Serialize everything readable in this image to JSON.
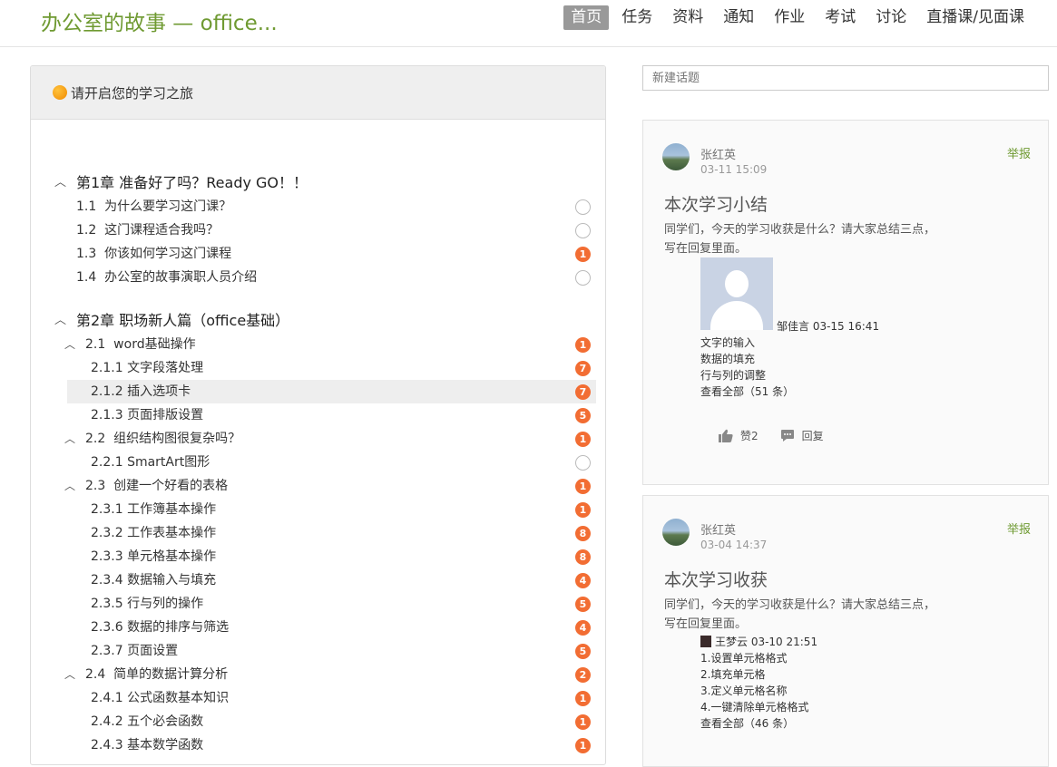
{
  "header": {
    "title": "办公室的故事 — office...",
    "nav": [
      "首页",
      "任务",
      "资料",
      "通知",
      "作业",
      "考试",
      "讨论",
      "直播课/见面课"
    ]
  },
  "course": {
    "banner": "请开启您的学习之旅",
    "chapters": [
      {
        "title": "第1章 准备好了吗？Ready GO！！",
        "items": [
          {
            "num": "1.1",
            "label": "为什么要学习这门课？",
            "badge": ""
          },
          {
            "num": "1.2",
            "label": "这门课程适合我吗？",
            "badge": ""
          },
          {
            "num": "1.3",
            "label": "你该如何学习这门课程",
            "badge": "1"
          },
          {
            "num": "1.4",
            "label": "办公室的故事演职人员介绍",
            "badge": ""
          }
        ]
      },
      {
        "title": "第2章 职场新人篇（office基础）",
        "sections": [
          {
            "num": "2.1",
            "label": "word基础操作",
            "badge": "1",
            "items": [
              {
                "label": "2.1.1 文字段落处理",
                "badge": "7"
              },
              {
                "label": "2.1.2 插入选项卡",
                "badge": "7"
              },
              {
                "label": "2.1.3 页面排版设置",
                "badge": "5"
              }
            ]
          },
          {
            "num": "2.2",
            "label": "组织结构图很复杂吗？",
            "badge": "1",
            "items": [
              {
                "label": "2.2.1 SmartArt图形",
                "badge": ""
              }
            ]
          },
          {
            "num": "2.3",
            "label": "创建一个好看的表格",
            "badge": "1",
            "items": [
              {
                "label": "2.3.1 工作簿基本操作",
                "badge": "1"
              },
              {
                "label": "2.3.2 工作表基本操作",
                "badge": "8"
              },
              {
                "label": "2.3.3 单元格基本操作",
                "badge": "8"
              },
              {
                "label": "2.3.4 数据输入与填充",
                "badge": "4"
              },
              {
                "label": "2.3.5 行与列的操作",
                "badge": "5"
              },
              {
                "label": "2.3.6 数据的排序与筛选",
                "badge": "4"
              },
              {
                "label": "2.3.7 页面设置",
                "badge": "5"
              }
            ]
          },
          {
            "num": "2.4",
            "label": "简单的数据计算分析",
            "badge": "2",
            "items": [
              {
                "label": "2.4.1 公式函数基本知识",
                "badge": "1"
              },
              {
                "label": "2.4.2 五个必会函数",
                "badge": "1"
              },
              {
                "label": "2.4.3 基本数学函数",
                "badge": "1"
              }
            ]
          }
        ]
      }
    ]
  },
  "feed": {
    "new_topic_placeholder": "新建话题",
    "posts": [
      {
        "author": "张红英",
        "date": "03-11 15:09",
        "report": "举报",
        "title": "本次学习小结",
        "body_line1": "同学们，今天的学习收获是什么？请大家总结三点，",
        "body_line2": "写在回复里面。",
        "reply_author_meta": "邹佳言 03-15 16:41",
        "reply_lines": [
          "文字的输入",
          "数据的填充",
          "行与列的调整"
        ],
        "view_all": "查看全部（51 条）",
        "like": "赞2",
        "reply": "回复"
      },
      {
        "author": "张红英",
        "date": "03-04 14:37",
        "report": "举报",
        "title": "本次学习收获",
        "body_line1": "同学们，今天的学习收获是什么？请大家总结三点，",
        "body_line2": "写在回复里面。",
        "reply_author_meta": "王梦云 03-10 21:51",
        "reply_lines": [
          "1.设置单元格格式",
          "2.填充单元格",
          "3.定义单元格名称",
          "4.一键清除单元格格式"
        ],
        "view_all": "查看全部（46 条）"
      }
    ]
  },
  "colors": {
    "brand": "#6f9a32",
    "badge": "#f26d33",
    "nav_active_bg": "#999999"
  }
}
